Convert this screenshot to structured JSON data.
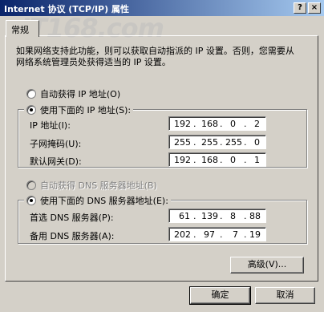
{
  "window": {
    "title": "Internet 协议 (TCP/IP) 属性",
    "help_glyph": "?",
    "close_glyph": "×"
  },
  "watermark": "IT168.com",
  "tab": {
    "label": "常规"
  },
  "intro": "如果网络支持此功能，则可以获取自动指派的 IP 设置。否则，您需要从网络系统管理员处获得适当的 IP 设置。",
  "ip_section": {
    "auto_label": "自动获得 IP 地址(O)",
    "manual_label": "使用下面的 IP 地址(S):",
    "auto_selected": false,
    "fields": [
      {
        "label": "IP 地址(I):",
        "octets": [
          "192",
          "168",
          "0",
          "2"
        ]
      },
      {
        "label": "子网掩码(U):",
        "octets": [
          "255",
          "255",
          "255",
          "0"
        ]
      },
      {
        "label": "默认网关(D):",
        "octets": [
          "192",
          "168",
          "0",
          "1"
        ]
      }
    ]
  },
  "dns_section": {
    "auto_label": "自动获得 DNS 服务器地址(B)",
    "manual_label": "使用下面的 DNS 服务器地址(E):",
    "auto_enabled": false,
    "fields": [
      {
        "label": "首选 DNS 服务器(P):",
        "octets": [
          "61",
          "139",
          "8",
          "88"
        ]
      },
      {
        "label": "备用 DNS 服务器(A):",
        "octets": [
          "202",
          "97",
          "7",
          "19"
        ]
      }
    ]
  },
  "buttons": {
    "advanced": "高级(V)...",
    "ok": "确定",
    "cancel": "取消"
  }
}
